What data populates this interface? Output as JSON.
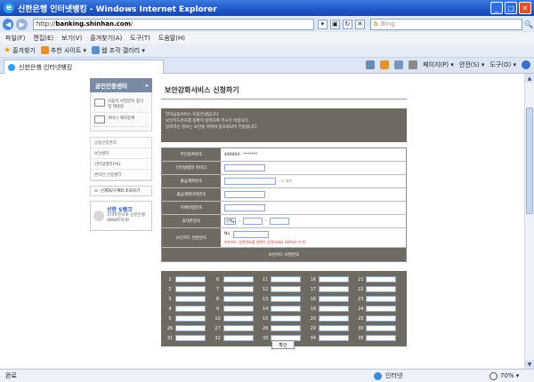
{
  "window": {
    "title": "신한은행 인터넷뱅킹 - Windows Internet Explorer",
    "minimize": "_",
    "maximize": "□",
    "close": "✕"
  },
  "address": {
    "url_prefix": "http://",
    "url_domain": "banking.shinhan.com",
    "url_suffix": "/",
    "search_placeholder": "Bing",
    "search_icon_glyph": "b",
    "go_glyph": "🔍"
  },
  "menu": [
    "파일(F)",
    "편집(E)",
    "보기(V)",
    "즐겨찾기(A)",
    "도구(T)",
    "도움말(H)"
  ],
  "favorites": {
    "label": "즐겨찾기",
    "items": [
      "추천 사이트 ▾",
      "웹 조각 갤러리 ▾"
    ]
  },
  "tab": {
    "label": "신한은행 인터넷뱅킹"
  },
  "commands": {
    "page": "페이지(P) ▾",
    "safety": "안전(S) ▾",
    "tools": "도구(O) ▾"
  },
  "sidebar": {
    "header": "공인인증센터",
    "arrow": "▸",
    "features": [
      "이용자 비밀번호 찾기 및 재설정",
      "서비스 해지등록"
    ],
    "links": [
      "공동인증관리",
      "보안센터",
      "인터넷뱅킹FAQ",
      "온라인 인증센터"
    ],
    "search_label": "신계좌/구계좌 조회하기",
    "banner_title": "신한 S뱅크",
    "banner_desc": "스마트폰으로 신한은행 SMART하게!"
  },
  "main": {
    "title": "보안강화서비스 신청하기",
    "notice_lines": [
      "전자금융서비스 이용안내입니다.",
      "보안카드번호를 정확히 입력하여 주시기 바랍니다.",
      "입력하신 정보는 보안을 위하여 암호화되어 전송됩니다."
    ],
    "form": {
      "rows": [
        {
          "label": "주민등록번호",
          "value": "440404 - *******"
        },
        {
          "label": "인터넷뱅킹 아이디",
          "value": ""
        },
        {
          "label": "출금계좌번호",
          "value": "",
          "note": "- 는 제외"
        },
        {
          "label": "출금계좌비밀번호",
          "value": ""
        },
        {
          "label": "이체비밀번호",
          "value": ""
        },
        {
          "label": "휴대폰번호",
          "select": "선택",
          "value": ""
        },
        {
          "label": "보안카드 일련번호",
          "prefix": "No.",
          "warn": "보안카드 일련번호를 정확히 입력하세요 (10자리 숫자)"
        }
      ],
      "footer": "보안카드 비밀번호"
    },
    "card_rows": [
      [
        1,
        6,
        11,
        16,
        21
      ],
      [
        2,
        7,
        12,
        17,
        22
      ],
      [
        3,
        8,
        13,
        18,
        23
      ],
      [
        4,
        9,
        14,
        19,
        24
      ],
      [
        5,
        10,
        15,
        20,
        25
      ],
      [
        26,
        27,
        28,
        29,
        30
      ],
      [
        31,
        32,
        33,
        34,
        35
      ]
    ],
    "confirm": "확인"
  },
  "status": {
    "text": "완료",
    "zone": "인터넷",
    "zoom": "70% ▾"
  },
  "scrollbar": {
    "up": "▲",
    "down": "▼"
  }
}
